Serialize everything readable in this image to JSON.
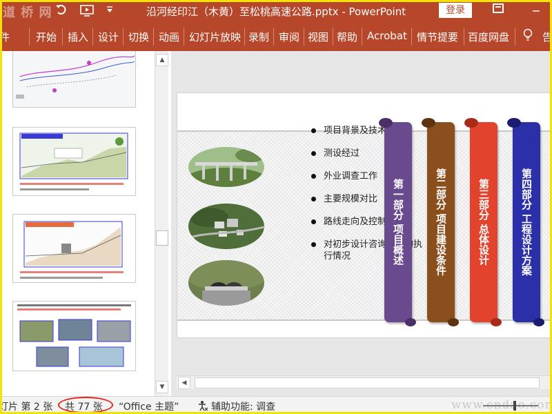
{
  "app": {
    "watermark_logo": "道 桥 网",
    "window_title": "沿河经印江（木黄）至松桃高速公路.pptx  -  PowerPoint",
    "login_label": "登录",
    "colors": {
      "accent": "#b7472a",
      "highlight_frame": "#f2e205",
      "annotation": "#e0271d"
    }
  },
  "quick_access": [
    "undo-icon",
    "redo-icon",
    "slideshow-from-start-icon",
    "customize-dropdown-icon"
  ],
  "ribbon_tabs": [
    "文件",
    "开始",
    "插入",
    "设计",
    "切换",
    "动画",
    "幻灯片放映",
    "录制",
    "审阅",
    "视图",
    "帮助",
    "Acrobat",
    "情节提要",
    "百度网盘"
  ],
  "ribbon_more": "告",
  "thumbnails": [
    {
      "label": "slide-thumb-1",
      "caption": ""
    },
    {
      "label": "slide-thumb-2",
      "caption": "图示高速公路及沿线 | 地形剖面示意"
    },
    {
      "label": "slide-thumb-3",
      "caption": "沿线地形剖面（分段）"
    },
    {
      "label": "slide-thumb-4",
      "caption": ""
    }
  ],
  "slide": {
    "bullets": [
      "项目背景及技术",
      "测设经过",
      "外业调查工作",
      "主要规模对比",
      "路线走向及控制",
      "对初步设计咨询意见的执行情况"
    ],
    "parts": [
      {
        "label": "第一部分  项目概述",
        "color": "#6a4a8e"
      },
      {
        "label": "第二部分  项目建设条件",
        "color": "#8b4f1e"
      },
      {
        "label": "第三部分  总体设计",
        "color": "#e2432c"
      },
      {
        "label": "第四部分  工程设计方案",
        "color": "#2b2fa8"
      }
    ]
  },
  "status": {
    "slide_position": "灯片 第 2 张",
    "total": "共 77 张",
    "theme": "“Office 主题”",
    "accessibility": "辅助功能: 调查",
    "site_watermark": "www.cndao.com"
  }
}
